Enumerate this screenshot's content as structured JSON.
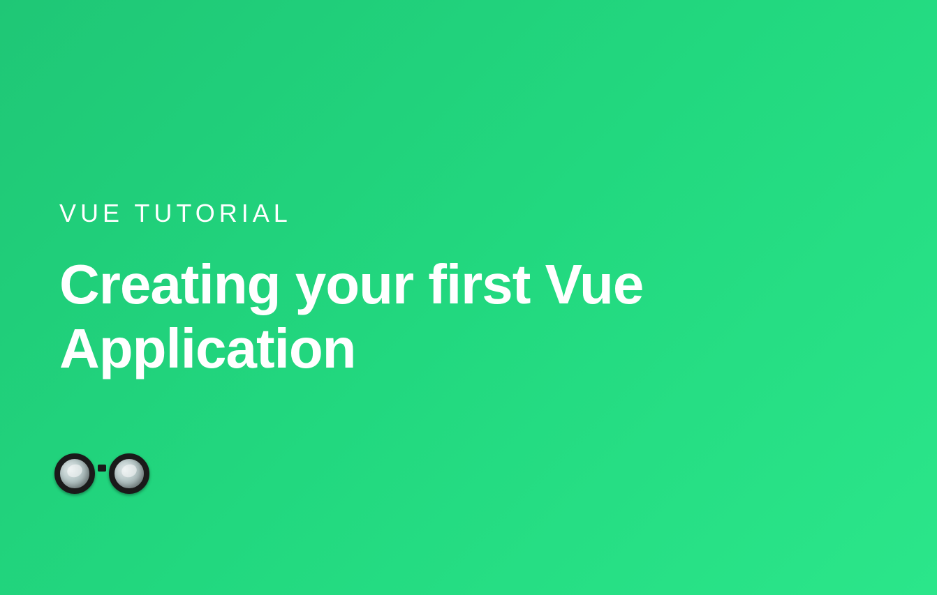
{
  "category": "VUE TUTORIAL",
  "title": "Creating your first Vue Application",
  "icon": "glasses-icon"
}
